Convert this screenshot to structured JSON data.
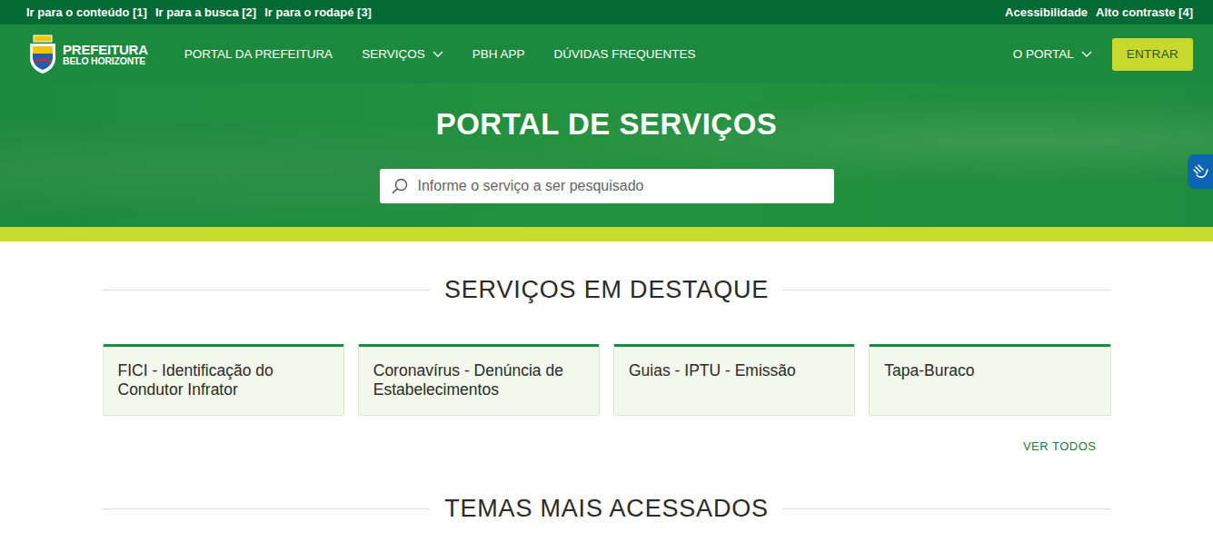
{
  "skip_links": [
    "Ir para o conteúdo [1]",
    "Ir para a busca [2]",
    "Ir para o rodapé [3]"
  ],
  "accessibility_links": [
    "Acessibilidade",
    "Alto contraste [4]"
  ],
  "logo": {
    "line1": "PREFEITURA",
    "line2": "BELO HORIZONTE"
  },
  "nav": [
    {
      "label": "PORTAL DA PREFEITURA",
      "dropdown": false
    },
    {
      "label": "SERVIÇOS",
      "dropdown": true
    },
    {
      "label": "PBH APP",
      "dropdown": false
    },
    {
      "label": "DÚVIDAS FREQUENTES",
      "dropdown": false
    }
  ],
  "nav_right": {
    "label": "O PORTAL",
    "dropdown": true
  },
  "login_button": "ENTRAR",
  "hero": {
    "title": "PORTAL DE SERVIÇOS",
    "search_placeholder": "Informe o serviço a ser pesquisado"
  },
  "featured": {
    "title": "SERVIÇOS EM DESTAQUE",
    "cards": [
      "FICI - Identificação do Condutor Infrator",
      "Coronavírus - Denúncia de Estabelecimentos",
      "Guias - IPTU - Emissão",
      "Tapa-Buraco"
    ],
    "see_all": "VER TODOS"
  },
  "themes": {
    "title": "TEMAS MAIS ACESSADOS"
  }
}
